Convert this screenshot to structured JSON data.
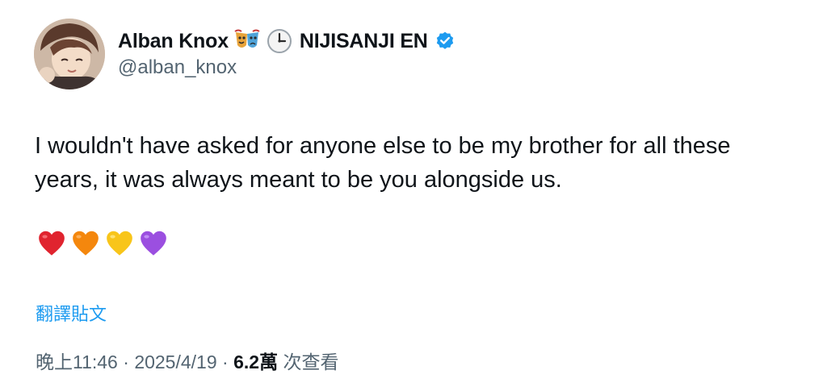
{
  "author": {
    "display_name": "Alban Knox",
    "name_emoji": "performing-arts-icon",
    "status_emoji": "clock-icon",
    "affiliation": "NIJISANJI EN",
    "verified_icon": "verified-badge-icon",
    "handle": "@alban_knox"
  },
  "tweet": {
    "text": "I wouldn't have asked for anyone else to be my brother for all these years, it was always meant to be you alongside us.",
    "hearts": [
      "red-heart-icon",
      "orange-heart-icon",
      "yellow-heart-icon",
      "purple-heart-icon"
    ],
    "translate_label": "翻譯貼文"
  },
  "meta": {
    "time": "晚上11:46",
    "sep1": " · ",
    "date": "2025/4/19",
    "sep2": " · ",
    "views": "6.2萬",
    "views_label": " 次查看"
  },
  "colors": {
    "accent": "#1d9bf0",
    "secondary_text": "#536471",
    "primary_text": "#0f1419"
  }
}
